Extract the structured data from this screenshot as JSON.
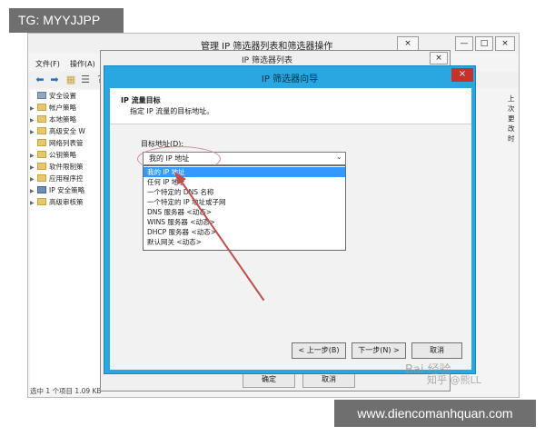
{
  "watermarks": {
    "top_left": "TG: MYYJJPP",
    "bottom_right": "www.diencomanhquan.com",
    "baidu": "Bai 经验",
    "zhihu": "知乎 @熊LL"
  },
  "mmc": {
    "title": "管理 IP 筛选器列表和筛选器操作",
    "controls": {
      "minimize": "—",
      "maximize": "□",
      "close": "×",
      "close_inner": "×"
    },
    "menu": [
      "文件(F)",
      "操作(A)"
    ],
    "right_hint": "上次更改时",
    "status": "选中 1 个项目 1.09 KB",
    "tree": [
      {
        "label": "安全设置",
        "expand": "",
        "folder": false
      },
      {
        "label": "帐户策略",
        "expand": "▶",
        "folder": true
      },
      {
        "label": "本地策略",
        "expand": "▶",
        "folder": true
      },
      {
        "label": "高级安全 W",
        "expand": "▶",
        "folder": true
      },
      {
        "label": "网络列表管",
        "expand": "",
        "folder": true
      },
      {
        "label": "公钥策略",
        "expand": "▶",
        "folder": true
      },
      {
        "label": "软件限制策",
        "expand": "▶",
        "folder": true
      },
      {
        "label": "应用程序控",
        "expand": "▶",
        "folder": true
      },
      {
        "label": "IP 安全策略",
        "expand": "▶",
        "folder": true
      },
      {
        "label": "高级审核策",
        "expand": "▶",
        "folder": true
      }
    ],
    "toolbar_icons": [
      "back-arrow",
      "forward-arrow",
      "folder",
      "list",
      "help"
    ]
  },
  "filter_list_dialog": {
    "title": "IP 筛选器列表",
    "close": "×",
    "ok_label": "确定",
    "cancel_label": "取消"
  },
  "wizard": {
    "title": "IP 筛选器向导",
    "close": "×",
    "heading": "IP 流量目标",
    "subheading": "指定 IP 流量的目标地址。",
    "address_label": "目标地址(D):",
    "combo_value": "我的 IP 地址",
    "combo_caret": "⌄",
    "options": [
      {
        "label": "我的 IP 地址",
        "selected": true
      },
      {
        "label": "任何 IP 地址",
        "selected": false
      },
      {
        "label": "一个特定的 DNS 名称",
        "selected": false
      },
      {
        "label": "一个特定的 IP 地址或子网",
        "selected": false
      },
      {
        "label": "DNS 服务器 <动态>",
        "selected": false
      },
      {
        "label": "WINS 服务器 <动态>",
        "selected": false
      },
      {
        "label": "DHCP 服务器 <动态>",
        "selected": false
      },
      {
        "label": "默认网关 <动态>",
        "selected": false
      }
    ],
    "back_label": "< 上一步(B)",
    "next_label": "下一步(N) >",
    "cancel_label": "取消"
  },
  "colors": {
    "wizard_frame": "#29a7e0",
    "selection": "#3399ff",
    "close_red": "#c8312a",
    "annotation_arrow": "#c0504d"
  }
}
